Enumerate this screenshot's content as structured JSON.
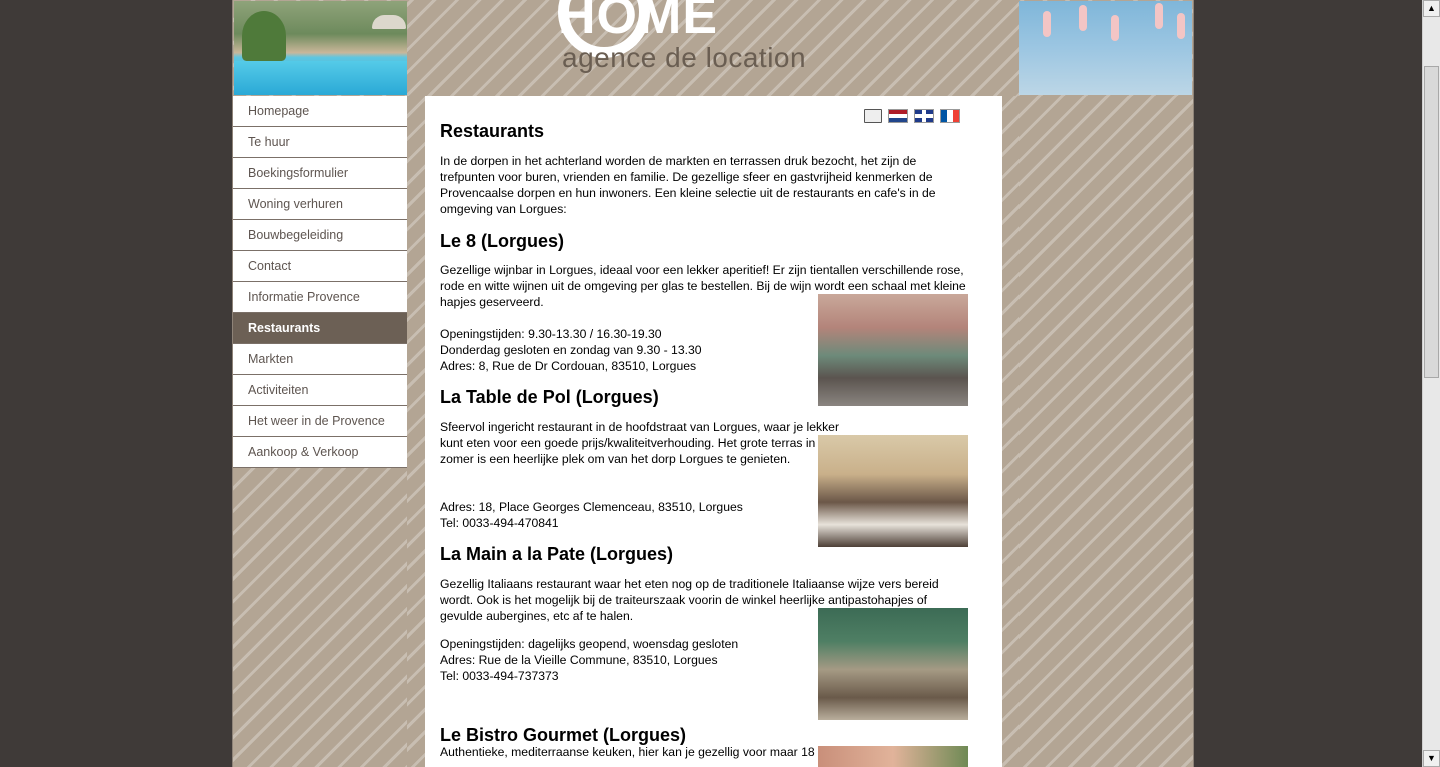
{
  "header": {
    "logo_main": "HOME",
    "logo_sub": "agence de location"
  },
  "nav": {
    "items": [
      {
        "label": "Homepage"
      },
      {
        "label": "Te huur"
      },
      {
        "label": "Boekingsformulier"
      },
      {
        "label": "Woning verhuren"
      },
      {
        "label": "Bouwbegeleiding"
      },
      {
        "label": "Contact"
      },
      {
        "label": "Informatie Provence"
      },
      {
        "label": "Restaurants"
      },
      {
        "label": "Markten"
      },
      {
        "label": "Activiteiten"
      },
      {
        "label": "Het weer in de Provence"
      },
      {
        "label": "Aankoop & Verkoop"
      }
    ],
    "active": "Restaurants"
  },
  "tools": {
    "icons": [
      "printer-icon",
      "flag-nl-icon",
      "flag-uk-icon",
      "flag-fr-icon"
    ]
  },
  "page": {
    "title": "Restaurants",
    "intro": "In de dorpen in het achterland worden de markten en terrassen druk bezocht, het zijn de trefpunten voor buren, vrienden en familie. De gezellige sfeer en gastvrijheid kenmerken de Provencaalse dorpen en hun inwoners. Een kleine selectie uit de restaurants en cafe's in de omgeving van Lorgues:",
    "restaurants": [
      {
        "name": "Le 8 (Lorgues)",
        "desc": "Gezellige wijnbar in Lorgues, ideaal voor een lekker aperitief! Er zijn tientallen verschillende rose, rode en witte wijnen uit de omgeving per glas te bestellen. Bij de wijn wordt een schaal met kleine hapjes geserveerd.",
        "lines": [
          "Openingstijden: 9.30-13.30 / 16.30-19.30",
          "Donderdag gesloten en zondag van 9.30 - 13.30",
          "Adres: 8, Rue de Dr Cordouan, 83510, Lorgues"
        ]
      },
      {
        "name": "La Table de Pol (Lorgues)",
        "desc": "Sfeervol ingericht restaurant in de hoofdstraat van Lorgues, waar je lekker kunt eten voor een goede prijs/kwaliteitverhouding. Het grote terras in de zomer is een heerlijke plek om van het dorp Lorgues te genieten.",
        "lines": [
          "Adres: 18, Place Georges Clemenceau, 83510, Lorgues",
          "Tel: 0033-494-470841"
        ]
      },
      {
        "name": "La Main a la Pate (Lorgues)",
        "desc": "Gezellig Italiaans restaurant waar het eten nog op de traditionele Italiaanse wijze vers bereid wordt. Ook is het mogelijk bij de traiteurszaak voorin de winkel heerlijke antipastohapjes of gevulde aubergines, etc af te halen.",
        "lines": [
          "Openingstijden: dagelijks geopend, woensdag gesloten",
          "Adres: Rue de la Vieille Commune, 83510, Lorgues",
          "Tel: 0033-494-737373"
        ]
      },
      {
        "name": "Le Bistro Gourmet (Lorgues)",
        "desc": "Authentieke, mediterraanse keuken, hier kan je gezellig voor maar 18"
      }
    ]
  }
}
